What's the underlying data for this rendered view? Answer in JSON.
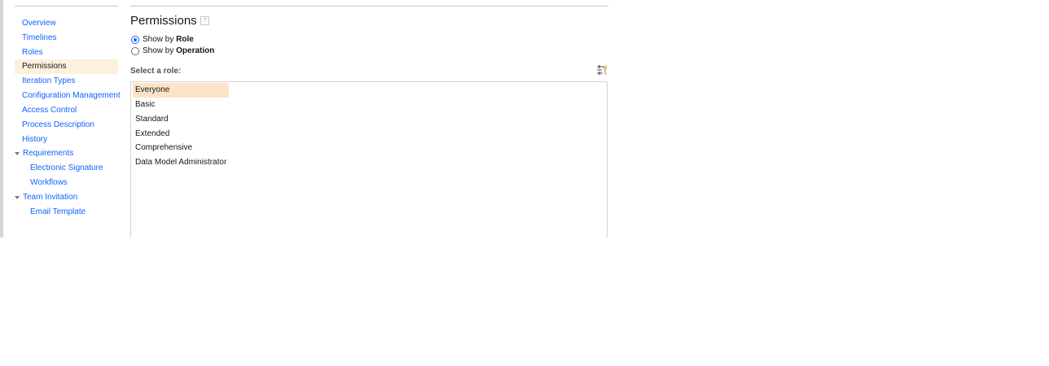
{
  "sidebar": {
    "items": [
      {
        "label": "Overview"
      },
      {
        "label": "Timelines"
      },
      {
        "label": "Roles"
      },
      {
        "label": "Permissions"
      },
      {
        "label": "Iteration Types"
      },
      {
        "label": "Configuration Management"
      },
      {
        "label": "Access Control"
      },
      {
        "label": "Process Description"
      },
      {
        "label": "History"
      },
      {
        "label": "Requirements"
      },
      {
        "label": "Electronic Signature"
      },
      {
        "label": "Workflows"
      },
      {
        "label": "Team Invitation"
      },
      {
        "label": "Email Template"
      }
    ],
    "selected": "Permissions"
  },
  "main": {
    "title": "Permissions",
    "help_icon": "?",
    "view_options": [
      {
        "prefix": "Show by ",
        "bold": "Role",
        "checked": true
      },
      {
        "prefix": "Show by ",
        "bold": "Operation",
        "checked": false
      }
    ],
    "select_label": "Select a role:",
    "filter_icon": "filter-settings-icon",
    "roles": [
      {
        "label": "Everyone"
      },
      {
        "label": "Basic"
      },
      {
        "label": "Standard"
      },
      {
        "label": "Extended"
      },
      {
        "label": "Comprehensive"
      },
      {
        "label": "Data Model Administrator"
      }
    ],
    "selected_role": "Everyone"
  },
  "colors": {
    "link": "#0f62fe",
    "selected_nav_bg": "#fdf0dd",
    "selected_role_bg": "#fde3c8"
  }
}
